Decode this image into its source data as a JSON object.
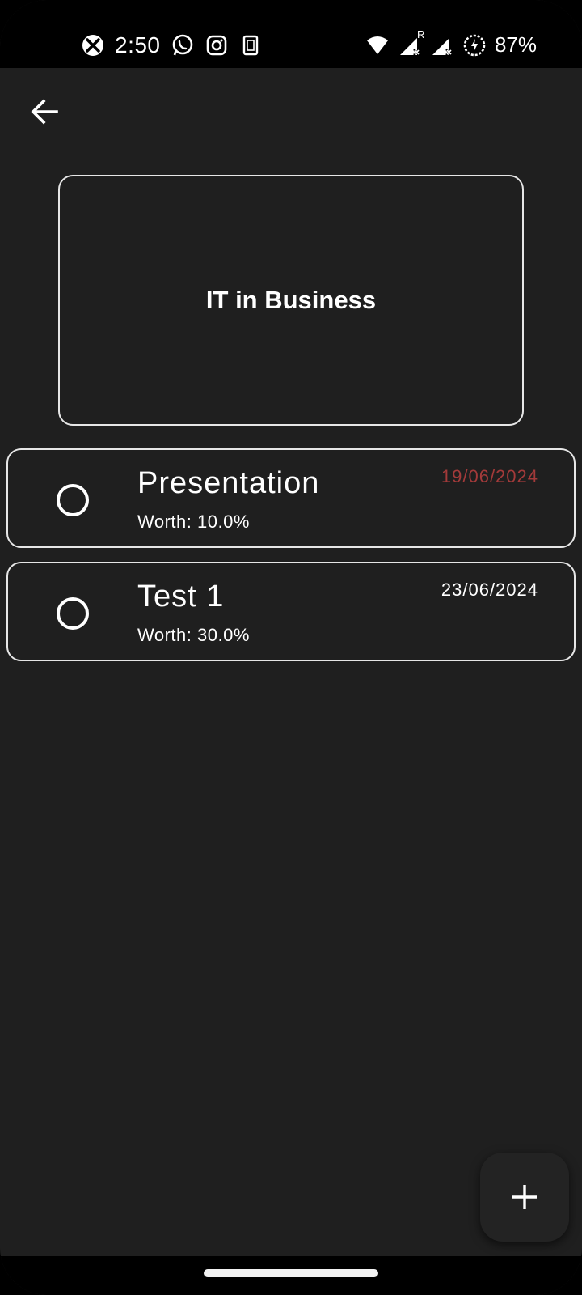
{
  "status_bar": {
    "time": "2:50",
    "battery": "87%",
    "left_icons": [
      "xbox-icon",
      "whatsapp-icon",
      "instagram-icon",
      "sim-icon"
    ],
    "right_icons": [
      "wifi-icon",
      "signal-roaming-icon",
      "signal-icon",
      "battery-saver-icon"
    ],
    "roaming_label": "R"
  },
  "app_bar": {
    "back_icon": "arrow-left-icon"
  },
  "course": {
    "title": "IT in Business"
  },
  "assessments": [
    {
      "name": "Presentation",
      "worth": "Worth: 10.0%",
      "date": "19/06/2024",
      "date_color": "#a33a3a",
      "completed": false
    },
    {
      "name": "Test 1",
      "worth": "Worth: 30.0%",
      "date": "23/06/2024",
      "date_color": "#ffffff",
      "completed": false
    }
  ],
  "fab": {
    "icon": "plus-icon"
  },
  "colors": {
    "background": "#1f1f1f",
    "border": "#e6e6e6",
    "text": "#ffffff",
    "overdue": "#a33a3a"
  }
}
